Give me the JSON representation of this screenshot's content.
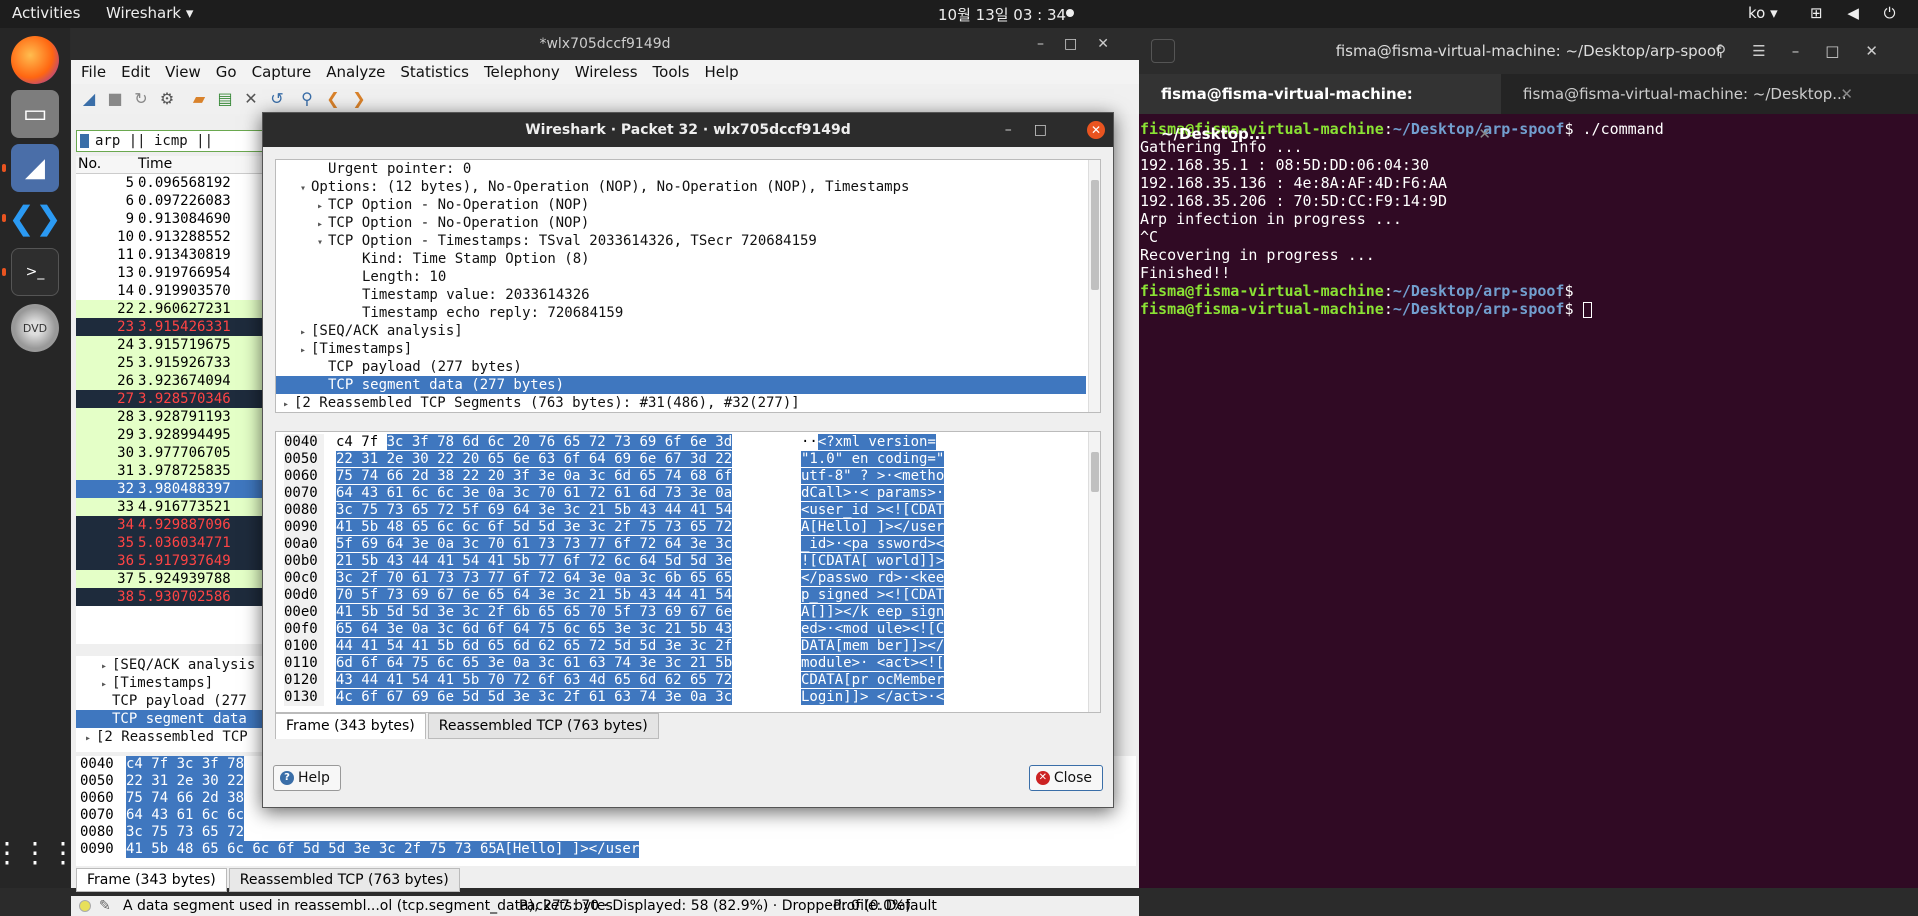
{
  "topbar": {
    "activities": "Activities",
    "app_menu": "Wireshark ▾",
    "clock": "10월 13일  03 : 34",
    "lang": "ko ▾",
    "system": "⊞ ◀ ⏻ ▾"
  },
  "wireshark": {
    "window_title": "*wlx705dccf9149d",
    "menu": [
      "File",
      "Edit",
      "View",
      "Go",
      "Capture",
      "Analyze",
      "Statistics",
      "Telephony",
      "Wireless",
      "Tools",
      "Help"
    ],
    "filter": "arp || icmp || tcp.port ==",
    "columns": {
      "no": "No.",
      "time": "Time"
    },
    "packets": [
      {
        "no": "5",
        "time": "0.096568192",
        "style": "plain"
      },
      {
        "no": "6",
        "time": "0.097226083",
        "style": "plain"
      },
      {
        "no": "9",
        "time": "0.913084690",
        "style": "plain"
      },
      {
        "no": "10",
        "time": "0.913288552",
        "style": "plain"
      },
      {
        "no": "11",
        "time": "0.913430819",
        "style": "plain"
      },
      {
        "no": "13",
        "time": "0.919766954",
        "style": "plain"
      },
      {
        "no": "14",
        "time": "0.919903570",
        "style": "plain"
      },
      {
        "no": "22",
        "time": "2.960627231",
        "style": "green"
      },
      {
        "no": "23",
        "time": "3.915426331",
        "style": "dark"
      },
      {
        "no": "24",
        "time": "3.915719675",
        "style": "green"
      },
      {
        "no": "25",
        "time": "3.915926733",
        "style": "green"
      },
      {
        "no": "26",
        "time": "3.923674094",
        "style": "green"
      },
      {
        "no": "27",
        "time": "3.928570346",
        "style": "dark"
      },
      {
        "no": "28",
        "time": "3.928791193",
        "style": "green"
      },
      {
        "no": "29",
        "time": "3.928994495",
        "style": "green"
      },
      {
        "no": "30",
        "time": "3.977706705",
        "style": "green"
      },
      {
        "no": "31",
        "time": "3.978725835",
        "style": "green"
      },
      {
        "no": "32",
        "time": "3.980488397",
        "style": "sel"
      },
      {
        "no": "33",
        "time": "4.916773521",
        "style": "green"
      },
      {
        "no": "34",
        "time": "4.929887096",
        "style": "dark"
      },
      {
        "no": "35",
        "time": "5.036034771",
        "style": "dark"
      },
      {
        "no": "36",
        "time": "5.917937649",
        "style": "dark"
      },
      {
        "no": "37",
        "time": "5.924939788",
        "style": "green"
      },
      {
        "no": "38",
        "time": "5.930702586",
        "style": "dark"
      }
    ],
    "lower_detail": [
      {
        "text": "[SEQ/ACK analysis",
        "indent": 2,
        "toggle": "▸",
        "sel": false
      },
      {
        "text": "[Timestamps]",
        "indent": 2,
        "toggle": "▸",
        "sel": false
      },
      {
        "text": "TCP payload (277",
        "indent": 2,
        "toggle": "",
        "sel": false
      },
      {
        "text": "TCP segment data",
        "indent": 2,
        "toggle": "",
        "sel": true
      },
      {
        "text": "[2 Reassembled TCP",
        "indent": 0,
        "toggle": "▸",
        "sel": false
      }
    ],
    "lower_hex": [
      {
        "off": "0040",
        "bytes": "c4 7f 3c 3f 78",
        "ascii": ""
      },
      {
        "off": "0050",
        "bytes": "22 31 2e 30 22",
        "ascii": ""
      },
      {
        "off": "0060",
        "bytes": "75 74 66 2d 38",
        "ascii": ""
      },
      {
        "off": "0070",
        "bytes": "64 43 61 6c 6c",
        "ascii": ""
      },
      {
        "off": "0080",
        "bytes": "3c 75 73 65 72",
        "ascii": ""
      },
      {
        "off": "0090",
        "bytes": "41 5b 48 65 6c 6c 6f 5d  5d 3e 3c 2f 75 73 65 72",
        "ascii": "A[Hello] ]></user"
      }
    ],
    "tabs": [
      "Frame (343 bytes)",
      "Reassembled TCP (763 bytes)"
    ],
    "status": {
      "field": "A data segment used in reassembl...ol (tcp.segment_data), 277 bytes",
      "packets": "Packets: 70 · Displayed: 58 (82.9%) · Dropped: 0 (0.0%)",
      "profile": "Profile: Default"
    }
  },
  "dialog": {
    "title": "Wireshark · Packet 32 · wlx705dccf9149d",
    "tree": [
      {
        "text": "Urgent pointer: 0",
        "indent": 2,
        "toggle": "",
        "sel": false
      },
      {
        "text": "Options: (12 bytes), No-Operation (NOP), No-Operation (NOP), Timestamps",
        "indent": 1,
        "toggle": "▾",
        "sel": false
      },
      {
        "text": "TCP Option - No-Operation (NOP)",
        "indent": 2,
        "toggle": "▸",
        "sel": false
      },
      {
        "text": "TCP Option - No-Operation (NOP)",
        "indent": 2,
        "toggle": "▸",
        "sel": false
      },
      {
        "text": "TCP Option - Timestamps: TSval 2033614326, TSecr 720684159",
        "indent": 2,
        "toggle": "▾",
        "sel": false
      },
      {
        "text": "Kind: Time Stamp Option (8)",
        "indent": 4,
        "toggle": "",
        "sel": false
      },
      {
        "text": "Length: 10",
        "indent": 4,
        "toggle": "",
        "sel": false
      },
      {
        "text": "Timestamp value: 2033614326",
        "indent": 4,
        "toggle": "",
        "sel": false
      },
      {
        "text": "Timestamp echo reply: 720684159",
        "indent": 4,
        "toggle": "",
        "sel": false
      },
      {
        "text": "[SEQ/ACK analysis]",
        "indent": 1,
        "toggle": "▸",
        "sel": false
      },
      {
        "text": "[Timestamps]",
        "indent": 1,
        "toggle": "▸",
        "sel": false
      },
      {
        "text": "TCP payload (277 bytes)",
        "indent": 2,
        "toggle": "",
        "sel": false
      },
      {
        "text": "TCP segment data (277 bytes)",
        "indent": 2,
        "toggle": "",
        "sel": true
      },
      {
        "text": "[2 Reassembled TCP Segments (763 bytes): #31(486), #32(277)]",
        "indent": 0,
        "toggle": "▸",
        "sel": false
      }
    ],
    "hex": [
      {
        "off": "0040",
        "pre": "c4 7f ",
        "bytes": "3c 3f 78 6d 6c 20  76 65 72 73 69 6f 6e 3d",
        "apre": "··",
        "ascii": "<?xml  version="
      },
      {
        "off": "0050",
        "pre": "",
        "bytes": "22 31 2e 30 22 20 65 6e  63 6f 64 69 6e 67 3d 22",
        "apre": "",
        "ascii": "\"1.0\" en coding=\""
      },
      {
        "off": "0060",
        "pre": "",
        "bytes": "75 74 66 2d 38 22 20 3f  3e 0a 3c 6d 65 74 68 6f",
        "apre": "",
        "ascii": "utf-8\" ? >·<metho"
      },
      {
        "off": "0070",
        "pre": "",
        "bytes": "64 43 61 6c 6c 3e 0a 3c  70 61 72 61 6d 73 3e 0a",
        "apre": "",
        "ascii": "dCall>·< params>·"
      },
      {
        "off": "0080",
        "pre": "",
        "bytes": "3c 75 73 65 72 5f 69 64  3e 3c 21 5b 43 44 41 54",
        "apre": "",
        "ascii": "<user_id ><![CDAT"
      },
      {
        "off": "0090",
        "pre": "",
        "bytes": "41 5b 48 65 6c 6c 6f 5d  5d 3e 3c 2f 75 73 65 72",
        "apre": "",
        "ascii": "A[Hello] ]></user"
      },
      {
        "off": "00a0",
        "pre": "",
        "bytes": "5f 69 64 3e 0a 3c 70 61  73 73 77 6f 72 64 3e 3c",
        "apre": "",
        "ascii": "_id>·<pa ssword><"
      },
      {
        "off": "00b0",
        "pre": "",
        "bytes": "21 5b 43 44 41 54 41 5b  77 6f 72 6c 64 5d 5d 3e",
        "apre": "",
        "ascii": "![CDATA[ world]]>"
      },
      {
        "off": "00c0",
        "pre": "",
        "bytes": "3c 2f 70 61 73 73 77 6f  72 64 3e 0a 3c 6b 65 65",
        "apre": "",
        "ascii": "</passwo rd>·<kee"
      },
      {
        "off": "00d0",
        "pre": "",
        "bytes": "70 5f 73 69 67 6e 65 64  3e 3c 21 5b 43 44 41 54",
        "apre": "",
        "ascii": "p_signed ><![CDAT"
      },
      {
        "off": "00e0",
        "pre": "",
        "bytes": "41 5b 5d 5d 3e 3c 2f 6b  65 65 70 5f 73 69 67 6e",
        "apre": "",
        "ascii": "A[]]></k eep_sign"
      },
      {
        "off": "00f0",
        "pre": "",
        "bytes": "65 64 3e 0a 3c 6d 6f 64  75 6c 65 3e 3c 21 5b 43",
        "apre": "",
        "ascii": "ed>·<mod ule><![C"
      },
      {
        "off": "0100",
        "pre": "",
        "bytes": "44 41 54 41 5b 6d 65 6d  62 65 72 5d 5d 3e 3c 2f",
        "apre": "",
        "ascii": "DATA[mem ber]]></"
      },
      {
        "off": "0110",
        "pre": "",
        "bytes": "6d 6f 64 75 6c 65 3e 0a  3c 61 63 74 3e 3c 21 5b",
        "apre": "",
        "ascii": "module>· <act><!["
      },
      {
        "off": "0120",
        "pre": "",
        "bytes": "43 44 41 54 41 5b 70 72  6f 63 4d 65 6d 62 65 72",
        "apre": "",
        "ascii": "CDATA[pr ocMember"
      },
      {
        "off": "0130",
        "pre": "",
        "bytes": "4c 6f 67 69 6e 5d 5d 3e  3c 2f 61 63 74 3e 0a 3c",
        "apre": "",
        "ascii": "Login]]> </act>·<"
      }
    ],
    "tabs": [
      "Frame (343 bytes)",
      "Reassembled TCP (763 bytes)"
    ],
    "help_label": "Help",
    "close_label": "Close"
  },
  "terminal": {
    "title": "fisma@fisma-virtual-machine: ~/Desktop/arp-spoof",
    "tabs": [
      "fisma@fisma-virtual-machine: ~/Desktop...",
      "fisma@fisma-virtual-machine: ~/Desktop..."
    ],
    "user": "fisma@fisma-virtual-machine",
    "path": "~/Desktop/arp-spoof",
    "command": "./command",
    "output": [
      "Gathering Info ...",
      "192.168.35.1 : 08:5D:DD:06:04:30",
      "192.168.35.136 : 4e:8A:AF:4D:F6:AA",
      "192.168.35.206 : 70:5D:CC:F9:14:9D",
      "Arp infection in progress ...",
      "^C",
      "Recovering in progress ...",
      "Finished!!"
    ]
  },
  "colors": {
    "selected": "#3f77bf",
    "tcp_green": "#e4ffc7",
    "dark_row": "#12272e",
    "terminal_bg": "#300a24",
    "ubuntu_orange": "#e95420"
  }
}
